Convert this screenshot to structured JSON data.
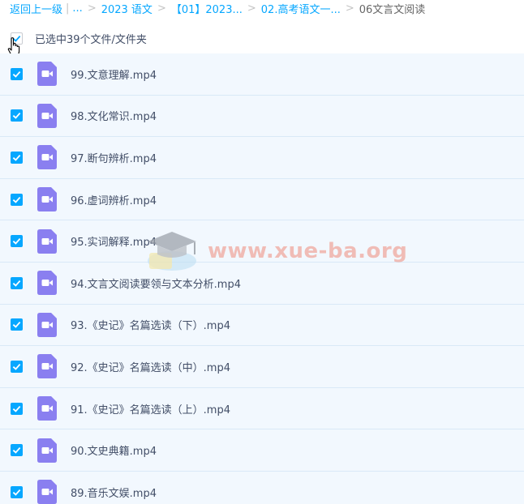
{
  "breadcrumb": {
    "back_label": "返回上一级",
    "ellipsis_label": "...",
    "items": [
      "2023 语文",
      "【01】2023...",
      "02.高考语文一...",
      "06文言文阅读"
    ]
  },
  "selection": {
    "summary": "已选中39个文件/文件夹"
  },
  "files": [
    {
      "name": "99.文意理解.mp4"
    },
    {
      "name": "98.文化常识.mp4"
    },
    {
      "name": "97.断句辨析.mp4"
    },
    {
      "name": "96.虚词辨析.mp4"
    },
    {
      "name": "95.实词解释.mp4"
    },
    {
      "name": "94.文言文阅读要领与文本分析.mp4"
    },
    {
      "name": "93.《史记》名篇选读（下）.mp4"
    },
    {
      "name": "92.《史记》名篇选读（中）.mp4"
    },
    {
      "name": "91.《史记》名篇选读（上）.mp4"
    },
    {
      "name": "90.文史典籍.mp4"
    },
    {
      "name": "89.音乐文娱.mp4"
    }
  ],
  "watermark": {
    "text": "www.xue-ba.org"
  },
  "colors": {
    "accent": "#06a7ff",
    "row_bg": "#f2f8fe",
    "video_icon": "#8a7ff0"
  }
}
